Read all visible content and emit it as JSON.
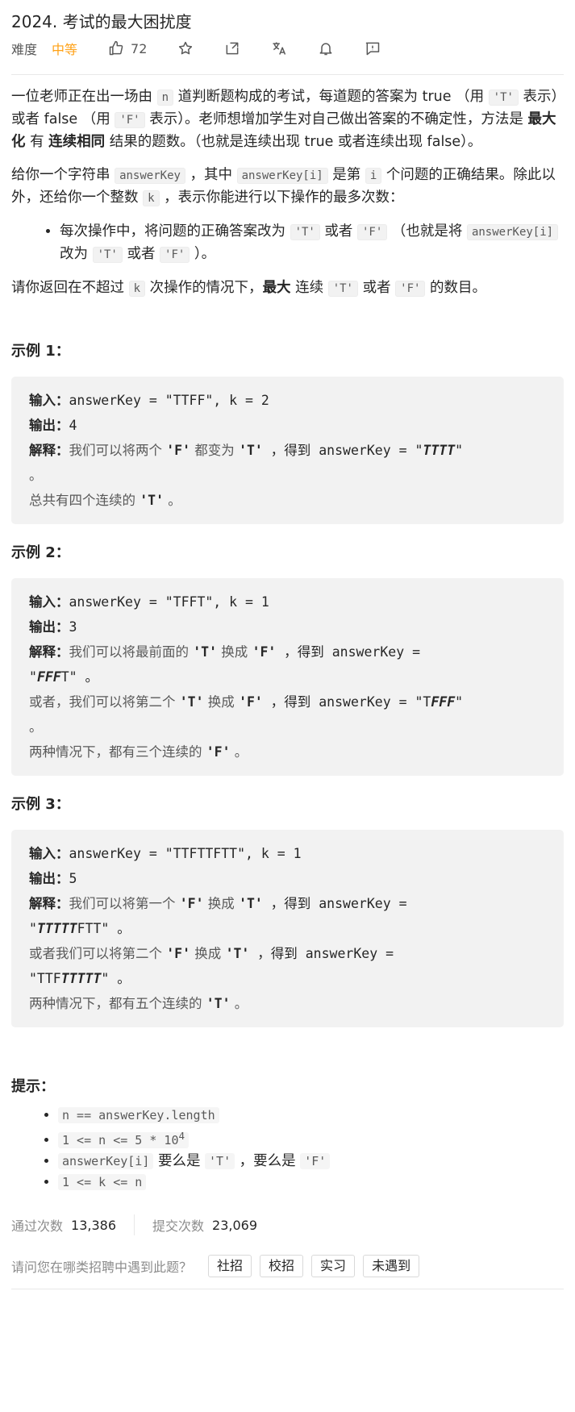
{
  "header": {
    "title": "2024. 考试的最大困扰度",
    "difficulty_label": "难度",
    "difficulty": "中等",
    "likes": "72"
  },
  "description": {
    "p1_a": "一位老师正在出一场由 ",
    "p1_n": "n",
    "p1_b": " 道判断题构成的考试，每道题的答案为 true （用 ",
    "p1_T": "'T'",
    "p1_c": " 表示）或者 false （用 ",
    "p1_F": "'F'",
    "p1_d": " 表示）。老师想增加学生对自己做出答案的不确定性，方法是 ",
    "p1_max": "最大化",
    "p1_e": " 有 ",
    "p1_cons": "连续相同",
    "p1_f": " 结果的题数。（也就是连续出现 true 或者连续出现 false）。",
    "p2_a": "给你一个字符串 ",
    "p2_key": "answerKey",
    "p2_b": " ，其中 ",
    "p2_keyi": "answerKey[i]",
    "p2_c": " 是第 ",
    "p2_i": "i",
    "p2_d": " 个问题的正确结果。除此以外，还给你一个整数 ",
    "p2_k": "k",
    "p2_e": " ，表示你能进行以下操作的最多次数：",
    "li_a": "每次操作中，将问题的正确答案改为 ",
    "li_T": "'T'",
    "li_b": " 或者 ",
    "li_F": "'F'",
    "li_c": " （也就是将 ",
    "li_keyi": "answerKey[i]",
    "li_d": " 改为 ",
    "li_T2": "'T'",
    "li_e": " 或者 ",
    "li_F2": "'F'",
    "li_f": " ）。",
    "p3_a": "请你返回在不超过 ",
    "p3_k": "k",
    "p3_b": " 次操作的情况下，",
    "p3_max": "最大",
    "p3_c": " 连续 ",
    "p3_T": "'T'",
    "p3_d": " 或者 ",
    "p3_F": "'F'",
    "p3_e": " 的数目。"
  },
  "examples": {
    "ex1_title": "示例 1：",
    "ex2_title": "示例 2：",
    "ex3_title": "示例 3：",
    "in_label": "输入：",
    "out_label": "输出：",
    "exp_label": "解释：",
    "ex1_in": "answerKey = \"TTFF\", k = 2",
    "ex1_out": "4",
    "ex1_e1": "我们可以将两个 ",
    "ex1_e2": "'F'",
    "ex1_e3": " 都变为 ",
    "ex1_e4": "'T'",
    "ex1_e5": " ，得到 answerKey = \"",
    "ex1_e6": "TTTT",
    "ex1_e7": "\"",
    "ex1_e8": "。",
    "ex1_l1": "总共有四个连续的 ",
    "ex1_l2": "'T'",
    "ex1_l3": " 。",
    "ex2_in": "answerKey = \"TFFT\", k = 1",
    "ex2_out": "3",
    "ex2_e1": "我们可以将最前面的 ",
    "ex2_e2": "'T'",
    "ex2_e3": " 换成 ",
    "ex2_e4": "'F'",
    "ex2_e5": " ，得到 answerKey =",
    "ex2_e6": "\"",
    "ex2_e7": "FFF",
    "ex2_e8": "T\" 。",
    "ex2_l1": "或者，我们可以将第二个 ",
    "ex2_l2": "'T'",
    "ex2_l3": " 换成 ",
    "ex2_l4": "'F'",
    "ex2_l5": " ，得到 answerKey = \"T",
    "ex2_l6": "FFF",
    "ex2_l7": "\"",
    "ex2_l8": "。",
    "ex2_m1": "两种情况下，都有三个连续的 ",
    "ex2_m2": "'F'",
    "ex2_m3": " 。",
    "ex3_in": "answerKey = \"TTFTTFTT\", k = 1",
    "ex3_out": "5",
    "ex3_e1": "我们可以将第一个 ",
    "ex3_e2": "'F'",
    "ex3_e3": " 换成 ",
    "ex3_e4": "'T'",
    "ex3_e5": " ，得到 answerKey =",
    "ex3_e6": "\"",
    "ex3_e7": "TTTTT",
    "ex3_e8": "FTT\" 。",
    "ex3_l1": "或者我们可以将第二个 ",
    "ex3_l2": "'F'",
    "ex3_l3": " 换成 ",
    "ex3_l4": "'T'",
    "ex3_l5": " ，得到 answerKey =",
    "ex3_l6": "\"TTF",
    "ex3_l7": "TTTTT",
    "ex3_l8": "\" 。",
    "ex3_m1": "两种情况下，都有五个连续的 ",
    "ex3_m2": "'T'",
    "ex3_m3": " 。"
  },
  "hints": {
    "title": "提示：",
    "h1": "n == answerKey.length",
    "h2": "1 <= n <= 5 * 10",
    "h2_sup": "4",
    "h3_code": "answerKey[i]",
    "h3_a": " 要么是 ",
    "h3_T": "'T'",
    "h3_b": " ，要么是 ",
    "h3_F": "'F'",
    "h4": "1 <= k <= n"
  },
  "stats": {
    "accepted_label": "通过次数",
    "accepted": "13,386",
    "submitted_label": "提交次数",
    "submitted": "23,069"
  },
  "recruit": {
    "question": "请问您在哪类招聘中遇到此题？",
    "tags": [
      "社招",
      "校招",
      "实习",
      "未遇到"
    ]
  }
}
